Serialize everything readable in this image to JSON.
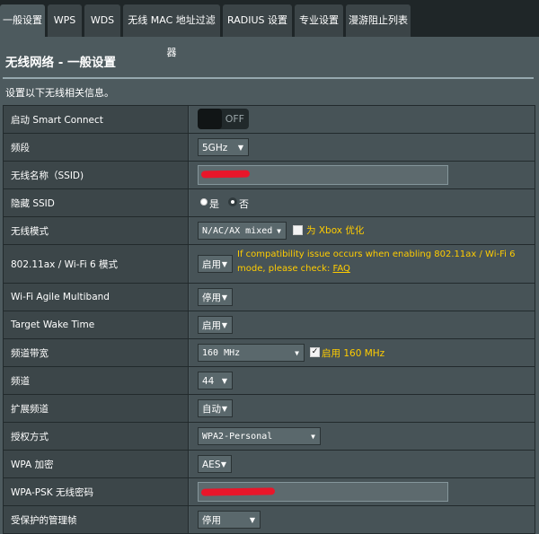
{
  "tabs": [
    "一般设置",
    "WPS",
    "WDS",
    "无线 MAC 地址过滤器",
    "RADIUS 设置",
    "专业设置",
    "漫游阻止列表"
  ],
  "page": {
    "title": "无线网络 - 一般设置",
    "description": "设置以下无线相关信息。"
  },
  "rows": {
    "smart_connect": {
      "label": "启动 Smart Connect",
      "toggle_text": "OFF",
      "enabled": false
    },
    "band": {
      "label": "频段",
      "value": "5GHz"
    },
    "ssid": {
      "label": "无线名称（SSID)",
      "value": ""
    },
    "hide_ssid": {
      "label": "隐藏 SSID",
      "opt_yes": "是",
      "opt_no": "否",
      "selected": "否"
    },
    "mode": {
      "label": "无线模式",
      "value": "N/AC/AX mixed",
      "xbox_label": "为 Xbox 优化",
      "xbox_checked": false
    },
    "wifi6": {
      "label": "802.11ax / Wi-Fi 6 模式",
      "value": "启用",
      "warning": "If compatibility issue occurs when enabling 802.11ax / Wi-Fi 6 mode, please check: ",
      "faq": "FAQ"
    },
    "agile": {
      "label": "Wi-Fi Agile Multiband",
      "value": "停用"
    },
    "twt": {
      "label": "Target Wake Time",
      "value": "启用"
    },
    "bandwidth": {
      "label": "频道带宽",
      "value": "160 MHz",
      "enable_label": "启用 160 MHz",
      "enable_checked": true
    },
    "channel": {
      "label": "频道",
      "value": "44"
    },
    "ext_channel": {
      "label": "扩展频道",
      "value": "自动"
    },
    "auth": {
      "label": "授权方式",
      "value": "WPA2-Personal"
    },
    "wpa_enc": {
      "label": "WPA 加密",
      "value": "AES"
    },
    "psk": {
      "label": "WPA-PSK 无线密码",
      "value": ""
    },
    "pmf": {
      "label": "受保护的管理帧",
      "value": "停用"
    }
  },
  "colors": {
    "accent_yellow": "#ffcc00",
    "redaction": "#e8162a"
  }
}
